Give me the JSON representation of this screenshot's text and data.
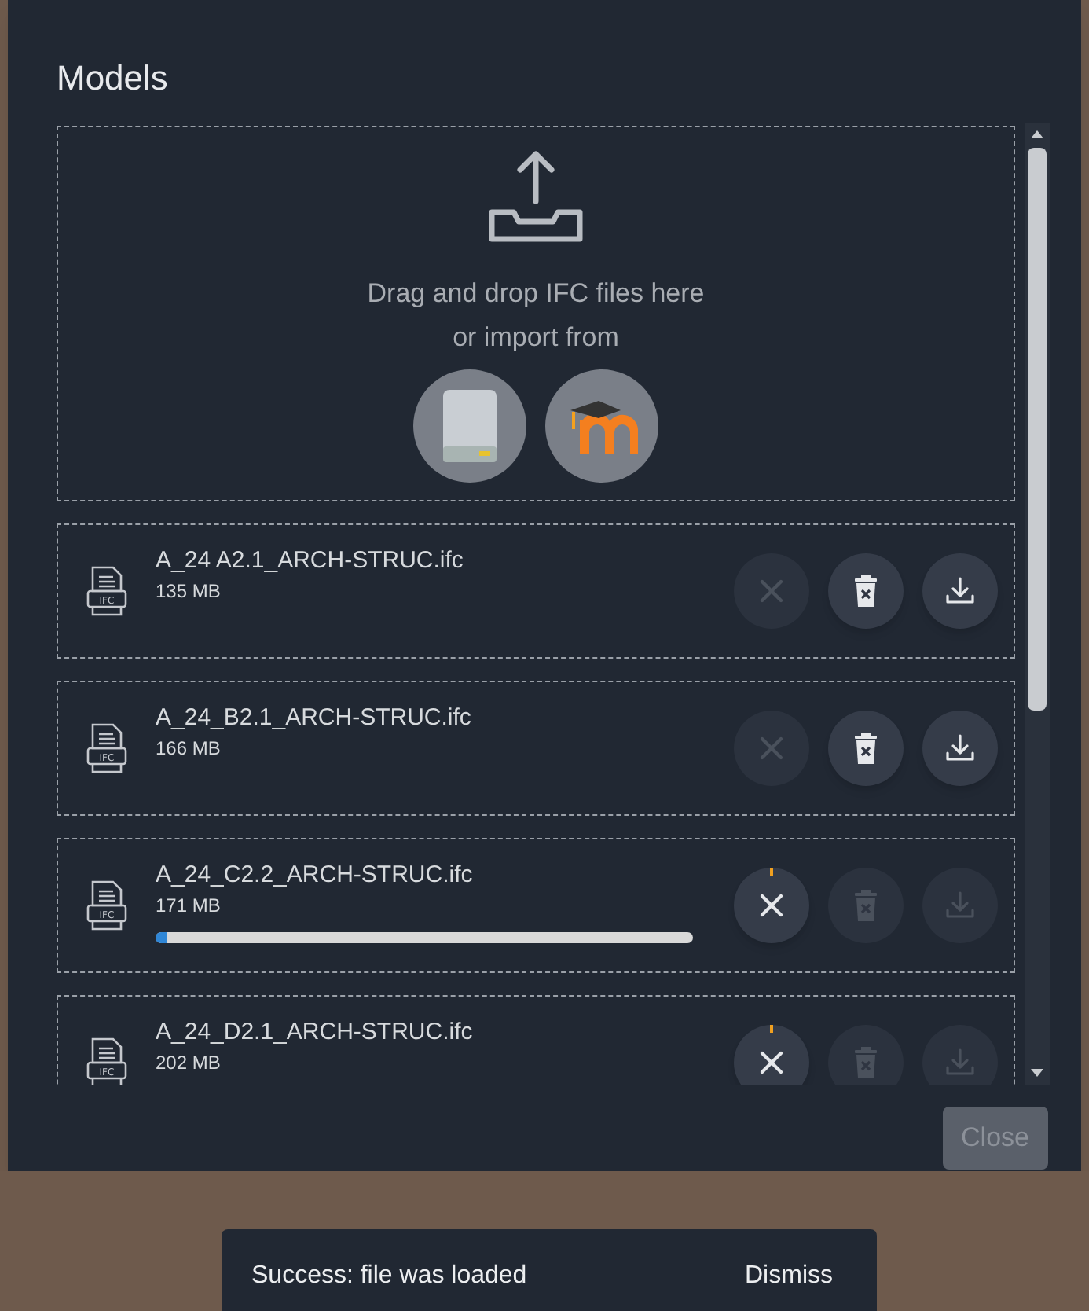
{
  "dialog": {
    "title": "Models"
  },
  "dropzone": {
    "lines": [
      "Drag and drop IFC files here",
      "or import from"
    ],
    "sources": [
      {
        "kind": "disk"
      },
      {
        "kind": "moodle"
      }
    ]
  },
  "files": [
    {
      "icon_label": "IFC",
      "name": "A_24 A2.1_ARCH-STRUC.ifc",
      "size": "135 MB",
      "loading": false,
      "actions": [
        {
          "kind": "cancel",
          "disabled": true
        },
        {
          "kind": "delete",
          "disabled": false
        },
        {
          "kind": "download",
          "disabled": false
        }
      ]
    },
    {
      "icon_label": "IFC",
      "name": "A_24_B2.1_ARCH-STRUC.ifc",
      "size": "166 MB",
      "loading": false,
      "actions": [
        {
          "kind": "cancel",
          "disabled": true
        },
        {
          "kind": "delete",
          "disabled": false
        },
        {
          "kind": "download",
          "disabled": false
        }
      ]
    },
    {
      "icon_label": "IFC",
      "name": "A_24_C2.2_ARCH-STRUC.ifc",
      "size": "171 MB",
      "loading": true,
      "progress": {
        "level": 0.02
      },
      "actions": [
        {
          "kind": "cancel",
          "disabled": false
        },
        {
          "kind": "delete",
          "disabled": true
        },
        {
          "kind": "download",
          "disabled": true
        }
      ]
    },
    {
      "icon_label": "IFC",
      "name": "A_24_D2.1_ARCH-STRUC.ifc",
      "size": "202 MB",
      "loading": true,
      "actions": [
        {
          "kind": "cancel",
          "disabled": false
        },
        {
          "kind": "delete",
          "disabled": true
        },
        {
          "kind": "download",
          "disabled": true
        }
      ]
    }
  ],
  "close_button": {
    "label": "Close",
    "disabled": true
  },
  "toast": {
    "message": "Success: file was loaded",
    "action": "Dismiss"
  }
}
